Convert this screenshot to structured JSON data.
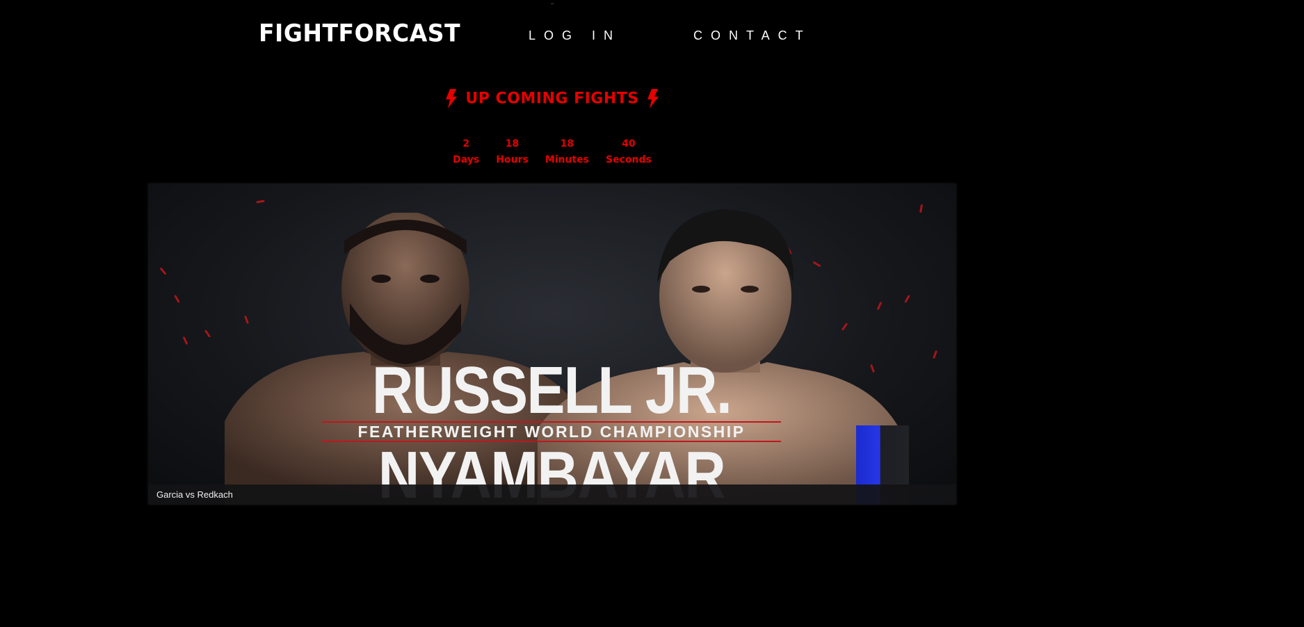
{
  "header": {
    "logo": "FIGHTFORCAST",
    "nav": {
      "login": "LOG IN",
      "contact": "CONTACT"
    }
  },
  "section": {
    "title": "UP COMING FIGHTS",
    "icon": "lightning-bolt-icon",
    "accent_color": "#e60000"
  },
  "countdown": [
    {
      "value": "2",
      "unit": "Days"
    },
    {
      "value": "18",
      "unit": "Hours"
    },
    {
      "value": "18",
      "unit": "Minutes"
    },
    {
      "value": "40",
      "unit": "Seconds"
    }
  ],
  "banner": {
    "fighter_top": "RUSSELL JR.",
    "subtitle": "FEATHERWEIGHT WORLD CHAMPIONSHIP",
    "fighter_bottom": "NYAMBAYAR",
    "caption": "Garcia vs Redkach"
  }
}
